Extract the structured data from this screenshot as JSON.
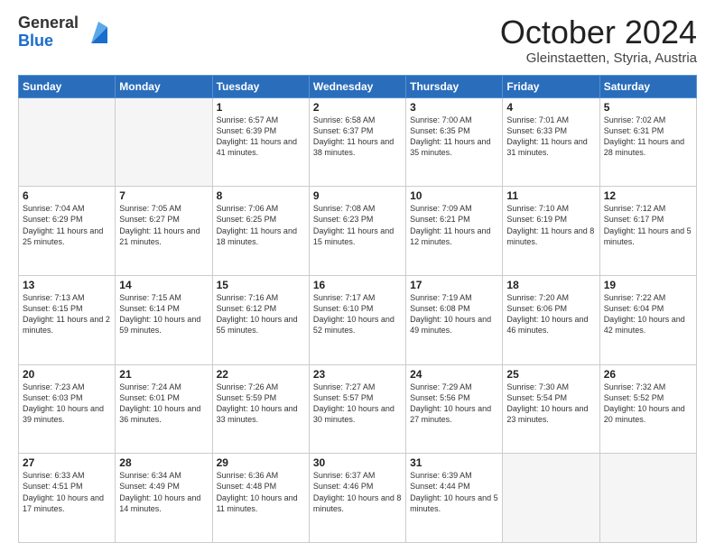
{
  "logo": {
    "general": "General",
    "blue": "Blue"
  },
  "header": {
    "month": "October 2024",
    "location": "Gleinstaetten, Styria, Austria"
  },
  "weekdays": [
    "Sunday",
    "Monday",
    "Tuesday",
    "Wednesday",
    "Thursday",
    "Friday",
    "Saturday"
  ],
  "weeks": [
    [
      {
        "day": "",
        "info": ""
      },
      {
        "day": "",
        "info": ""
      },
      {
        "day": "1",
        "info": "Sunrise: 6:57 AM\nSunset: 6:39 PM\nDaylight: 11 hours and 41 minutes."
      },
      {
        "day": "2",
        "info": "Sunrise: 6:58 AM\nSunset: 6:37 PM\nDaylight: 11 hours and 38 minutes."
      },
      {
        "day": "3",
        "info": "Sunrise: 7:00 AM\nSunset: 6:35 PM\nDaylight: 11 hours and 35 minutes."
      },
      {
        "day": "4",
        "info": "Sunrise: 7:01 AM\nSunset: 6:33 PM\nDaylight: 11 hours and 31 minutes."
      },
      {
        "day": "5",
        "info": "Sunrise: 7:02 AM\nSunset: 6:31 PM\nDaylight: 11 hours and 28 minutes."
      }
    ],
    [
      {
        "day": "6",
        "info": "Sunrise: 7:04 AM\nSunset: 6:29 PM\nDaylight: 11 hours and 25 minutes."
      },
      {
        "day": "7",
        "info": "Sunrise: 7:05 AM\nSunset: 6:27 PM\nDaylight: 11 hours and 21 minutes."
      },
      {
        "day": "8",
        "info": "Sunrise: 7:06 AM\nSunset: 6:25 PM\nDaylight: 11 hours and 18 minutes."
      },
      {
        "day": "9",
        "info": "Sunrise: 7:08 AM\nSunset: 6:23 PM\nDaylight: 11 hours and 15 minutes."
      },
      {
        "day": "10",
        "info": "Sunrise: 7:09 AM\nSunset: 6:21 PM\nDaylight: 11 hours and 12 minutes."
      },
      {
        "day": "11",
        "info": "Sunrise: 7:10 AM\nSunset: 6:19 PM\nDaylight: 11 hours and 8 minutes."
      },
      {
        "day": "12",
        "info": "Sunrise: 7:12 AM\nSunset: 6:17 PM\nDaylight: 11 hours and 5 minutes."
      }
    ],
    [
      {
        "day": "13",
        "info": "Sunrise: 7:13 AM\nSunset: 6:15 PM\nDaylight: 11 hours and 2 minutes."
      },
      {
        "day": "14",
        "info": "Sunrise: 7:15 AM\nSunset: 6:14 PM\nDaylight: 10 hours and 59 minutes."
      },
      {
        "day": "15",
        "info": "Sunrise: 7:16 AM\nSunset: 6:12 PM\nDaylight: 10 hours and 55 minutes."
      },
      {
        "day": "16",
        "info": "Sunrise: 7:17 AM\nSunset: 6:10 PM\nDaylight: 10 hours and 52 minutes."
      },
      {
        "day": "17",
        "info": "Sunrise: 7:19 AM\nSunset: 6:08 PM\nDaylight: 10 hours and 49 minutes."
      },
      {
        "day": "18",
        "info": "Sunrise: 7:20 AM\nSunset: 6:06 PM\nDaylight: 10 hours and 46 minutes."
      },
      {
        "day": "19",
        "info": "Sunrise: 7:22 AM\nSunset: 6:04 PM\nDaylight: 10 hours and 42 minutes."
      }
    ],
    [
      {
        "day": "20",
        "info": "Sunrise: 7:23 AM\nSunset: 6:03 PM\nDaylight: 10 hours and 39 minutes."
      },
      {
        "day": "21",
        "info": "Sunrise: 7:24 AM\nSunset: 6:01 PM\nDaylight: 10 hours and 36 minutes."
      },
      {
        "day": "22",
        "info": "Sunrise: 7:26 AM\nSunset: 5:59 PM\nDaylight: 10 hours and 33 minutes."
      },
      {
        "day": "23",
        "info": "Sunrise: 7:27 AM\nSunset: 5:57 PM\nDaylight: 10 hours and 30 minutes."
      },
      {
        "day": "24",
        "info": "Sunrise: 7:29 AM\nSunset: 5:56 PM\nDaylight: 10 hours and 27 minutes."
      },
      {
        "day": "25",
        "info": "Sunrise: 7:30 AM\nSunset: 5:54 PM\nDaylight: 10 hours and 23 minutes."
      },
      {
        "day": "26",
        "info": "Sunrise: 7:32 AM\nSunset: 5:52 PM\nDaylight: 10 hours and 20 minutes."
      }
    ],
    [
      {
        "day": "27",
        "info": "Sunrise: 6:33 AM\nSunset: 4:51 PM\nDaylight: 10 hours and 17 minutes."
      },
      {
        "day": "28",
        "info": "Sunrise: 6:34 AM\nSunset: 4:49 PM\nDaylight: 10 hours and 14 minutes."
      },
      {
        "day": "29",
        "info": "Sunrise: 6:36 AM\nSunset: 4:48 PM\nDaylight: 10 hours and 11 minutes."
      },
      {
        "day": "30",
        "info": "Sunrise: 6:37 AM\nSunset: 4:46 PM\nDaylight: 10 hours and 8 minutes."
      },
      {
        "day": "31",
        "info": "Sunrise: 6:39 AM\nSunset: 4:44 PM\nDaylight: 10 hours and 5 minutes."
      },
      {
        "day": "",
        "info": ""
      },
      {
        "day": "",
        "info": ""
      }
    ]
  ]
}
